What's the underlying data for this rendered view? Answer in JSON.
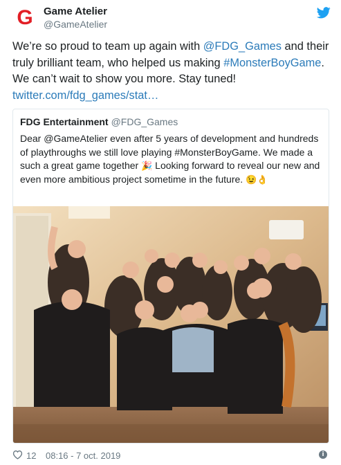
{
  "author": {
    "name": "Game Atelier",
    "handle": "@GameAtelier",
    "avatar_letter": "G",
    "avatar_color": "#e21f26"
  },
  "tweet": {
    "line1_pre": "We’re so proud to team up again with ",
    "mention": "@FDG_Games",
    "line1_post": " and their",
    "line2_pre": "truly brilliant team, who helped us making ",
    "hashtag": "#MonsterBoyGame",
    "line2_post": ".",
    "line3": "We can’t wait to show you more. Stay tuned!",
    "link": "twitter.com/fdg_games/stat…"
  },
  "quoted": {
    "author": "FDG Entertainment",
    "handle": "@FDG_Games",
    "text_part1": "Dear @GameAtelier even after 5 years of development and hundreds of playthroughs we still love playing #MonsterBoyGame. We made a such a great game together ",
    "emoji1": "🎉",
    "text_part2": " Looking forward to reveal our new and even more ambitious project sometime in the future. ",
    "emoji2": "😉👌",
    "photo_alt": "group-photo"
  },
  "footer": {
    "likes": "12",
    "datetime": "08:16 - 7 oct. 2019",
    "info_glyph": "i"
  },
  "colors": {
    "link": "#2b7bb9",
    "secondary": "#697882",
    "border": "#e1e8ed",
    "twitter_blue": "#1da1f2"
  }
}
